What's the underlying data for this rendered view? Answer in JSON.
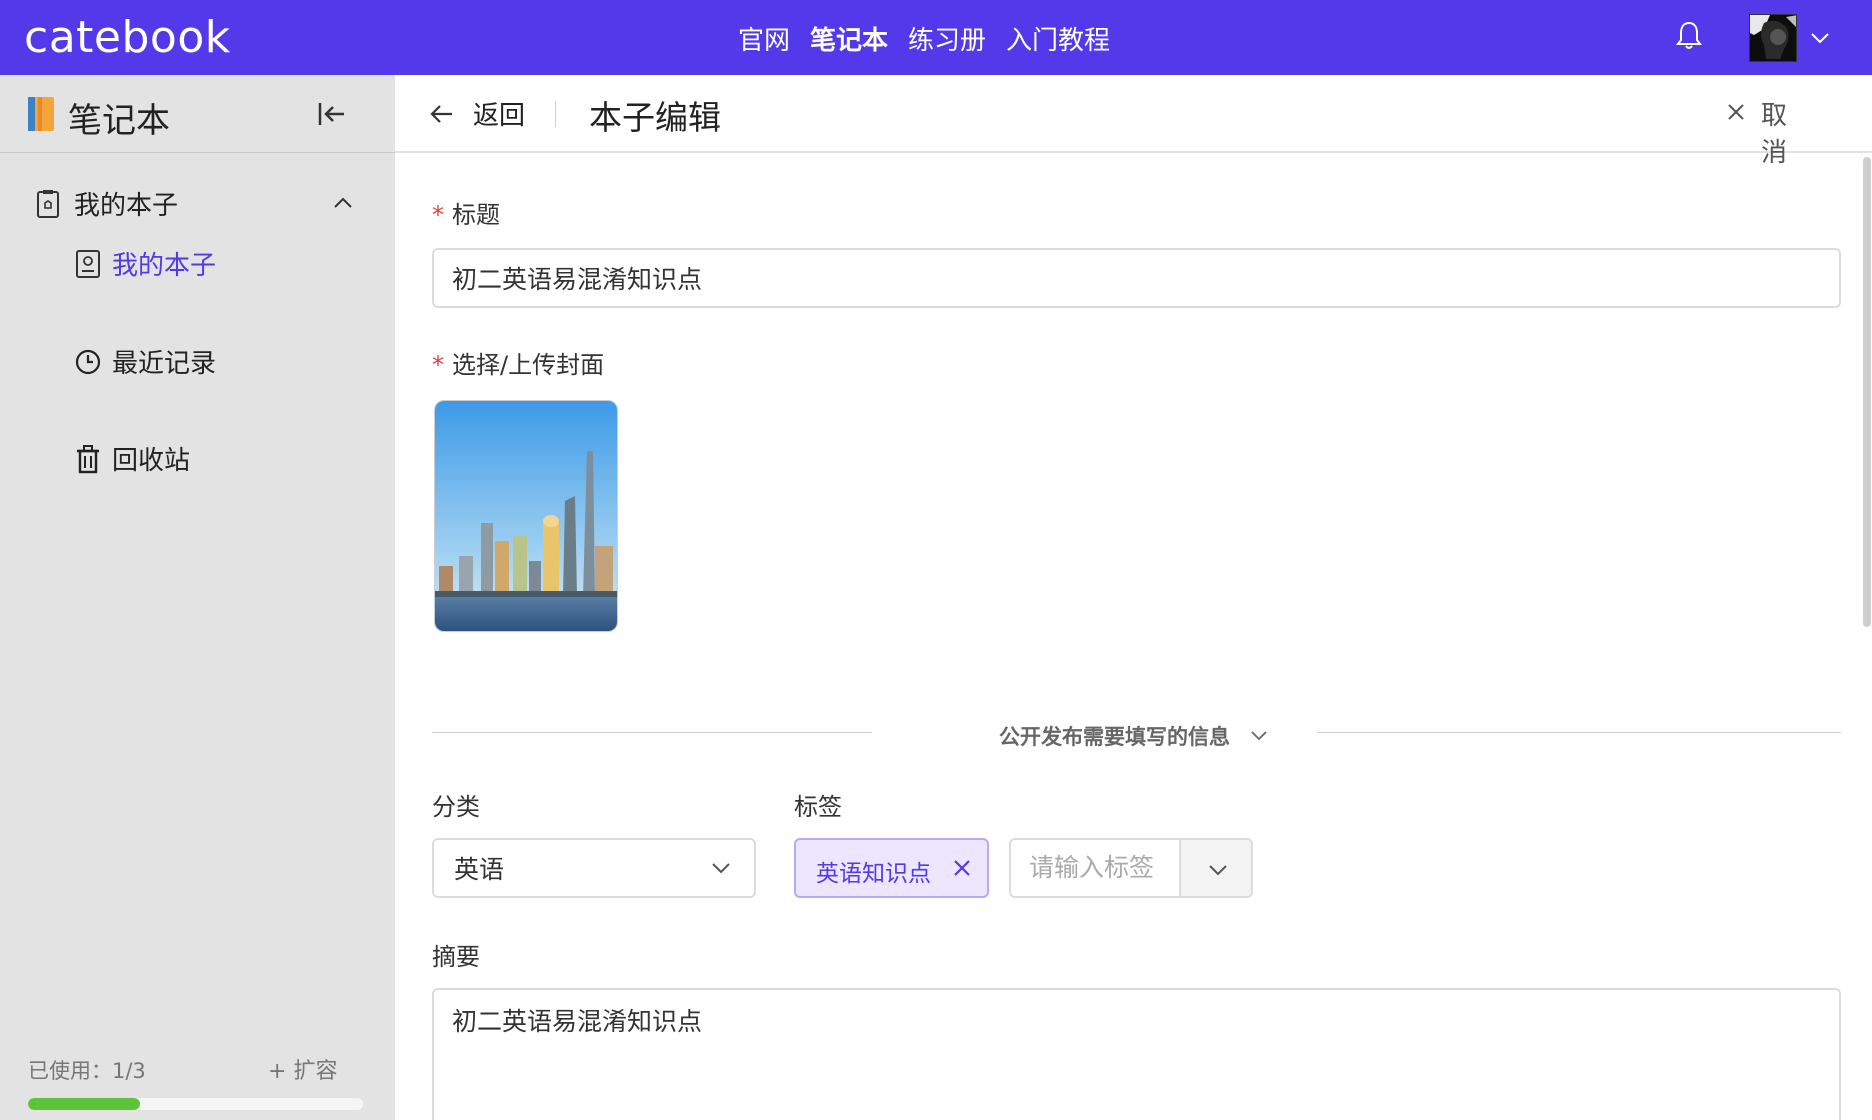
{
  "app": {
    "logo": "catebook"
  },
  "nav": {
    "items": [
      "官网",
      "笔记本",
      "练习册",
      "入门教程"
    ],
    "active_index": 1
  },
  "header_icons": [
    "bell-icon",
    "user-avatar",
    "chevron-down-icon"
  ],
  "sidebar": {
    "title": "笔记本",
    "group": {
      "label": "我的本子",
      "expanded": true
    },
    "items": [
      {
        "label": "我的本子",
        "icon": "notebook-icon",
        "active": true
      },
      {
        "label": "最近记录",
        "icon": "clock-icon",
        "active": false
      },
      {
        "label": "回收站",
        "icon": "trash-icon",
        "active": false
      }
    ],
    "usage_label": "已使用：1/3",
    "usage_fraction": 0.333,
    "expand_label": "扩容"
  },
  "page": {
    "back_label": "返回",
    "title": "本子编辑",
    "cancel_label": "取 消"
  },
  "form": {
    "title_label": "标题",
    "title_value": "初二英语易混淆知识点",
    "cover_label": "选择/上传封面",
    "public_info_label": "公开发布需要填写的信息",
    "category_label": "分类",
    "category_value": "英语",
    "tags_label": "标签",
    "tags": [
      "英语知识点"
    ],
    "tag_placeholder": "请输入标签",
    "summary_label": "摘要",
    "summary_value": "初二英语易混淆知识点"
  },
  "colors": {
    "accent": "#5339ea",
    "progress": "#5cc33b",
    "required": "#e04040",
    "sidebar_bg": "#e3e3e3"
  }
}
